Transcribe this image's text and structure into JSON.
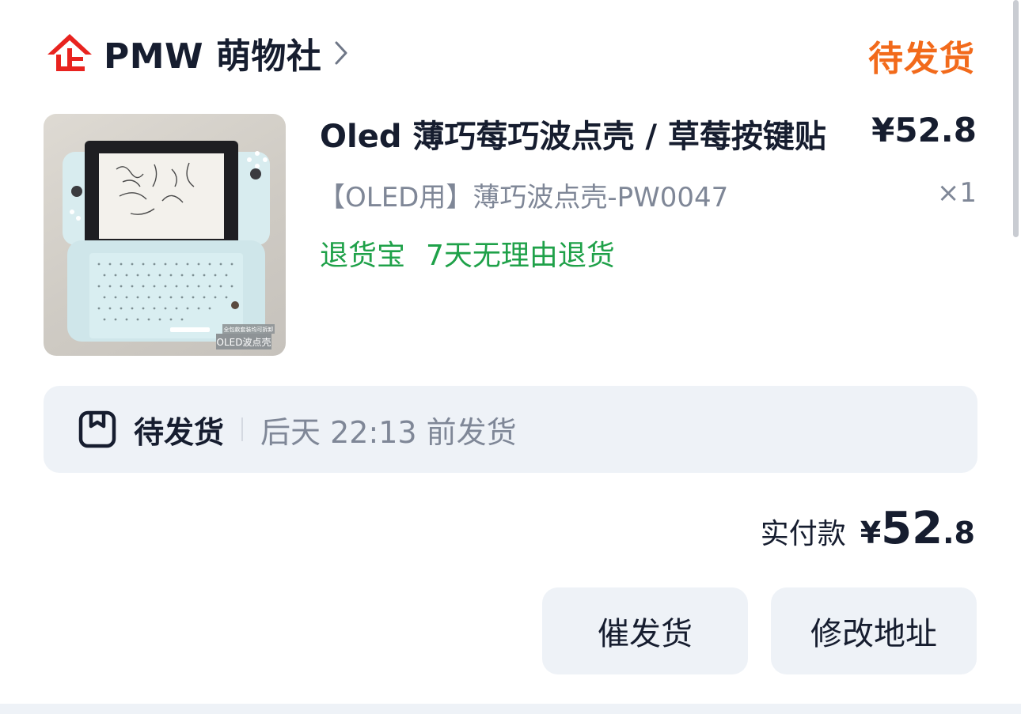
{
  "shop": {
    "name": "PMW 萌物社",
    "logo_icon": "enterprise-shop-icon",
    "logo_color": "#e8231f",
    "chevron_icon": "chevron-right-icon"
  },
  "order": {
    "status": "待发货",
    "status_color": "#f26a1b"
  },
  "product": {
    "title": "Oled 薄巧莓巧波点壳 / 草莓按键贴",
    "price": "¥52.8",
    "variant": "【OLED用】薄巧波点壳-PW0047",
    "quantity": "×1",
    "thumbnail_caption": "OLED波点壳",
    "thumbnail_small_text": "全包款套装均可拆卸",
    "return_tags": [
      "退货宝",
      "7天无理由退货"
    ],
    "return_tag_color": "#1fa149"
  },
  "shipping": {
    "icon": "package-box-icon",
    "status": "待发货",
    "deadline": "后天 22:13 前发货"
  },
  "payment": {
    "label": "实付款",
    "currency": "¥",
    "amount_integer": "52",
    "amount_decimal": ".8"
  },
  "actions": {
    "urge_label": "催发货",
    "change_address_label": "修改地址"
  }
}
